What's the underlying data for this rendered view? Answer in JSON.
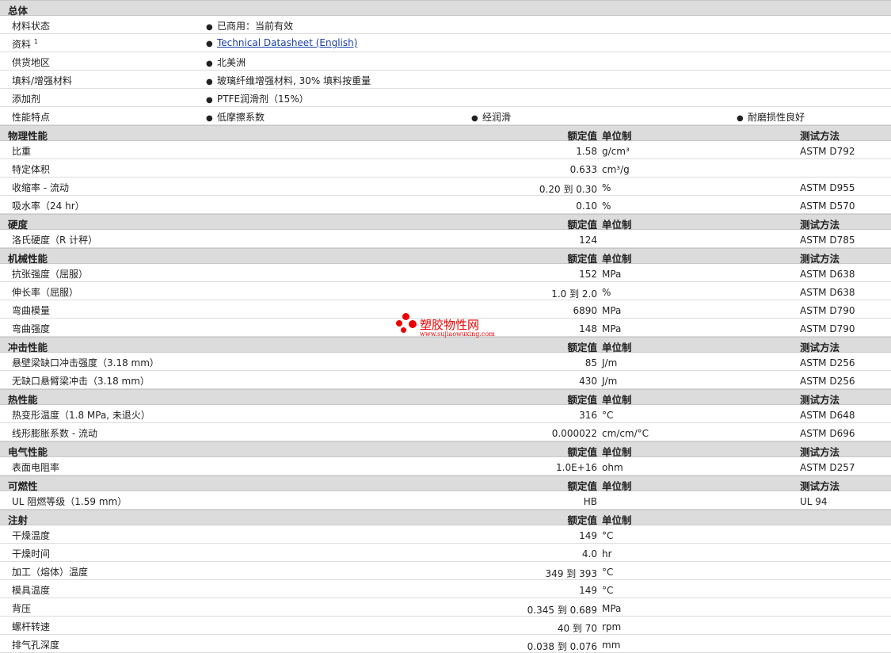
{
  "general": {
    "title": "总体",
    "rows": [
      {
        "label": "材料状态",
        "items": [
          "已商用：当前有效"
        ]
      },
      {
        "label": "资料",
        "sup": "1",
        "link": "Technical Datasheet (English)"
      },
      {
        "label": "供货地区",
        "items": [
          "北美洲"
        ]
      },
      {
        "label": "填料/增强材料",
        "items": [
          "玻璃纤维增强材料, 30% 填料按重量"
        ]
      },
      {
        "label": "添加剂",
        "items": [
          "PTFE润滑剂（15%）"
        ]
      },
      {
        "label": "性能特点",
        "items": [
          "低摩擦系数",
          "经润滑",
          "耐磨损性良好"
        ]
      }
    ]
  },
  "headers": {
    "value": "额定值",
    "unit": "单位制",
    "method": "测试方法"
  },
  "sections": [
    {
      "title": "物理性能",
      "method_header": true,
      "rows": [
        {
          "label": "比重",
          "value": "1.58",
          "unit": "g/cm³",
          "method": "ASTM D792"
        },
        {
          "label": "特定体积",
          "value": "0.633",
          "unit": "cm³/g",
          "method": ""
        },
        {
          "label": "收缩率 - 流动",
          "value": "0.20 到  0.30",
          "unit": "%",
          "method": "ASTM D955"
        },
        {
          "label": "吸水率（24 hr）",
          "value": "0.10",
          "unit": "%",
          "method": "ASTM D570"
        }
      ]
    },
    {
      "title": "硬度",
      "method_header": true,
      "rows": [
        {
          "label": "洛氏硬度（R 计秤）",
          "value": "124",
          "unit": "",
          "method": "ASTM D785"
        }
      ]
    },
    {
      "title": "机械性能",
      "method_header": true,
      "rows": [
        {
          "label": "抗张强度（屈服）",
          "value": "152",
          "unit": "MPa",
          "method": "ASTM D638"
        },
        {
          "label": "伸长率（屈服）",
          "value": "1.0 到  2.0",
          "unit": "%",
          "method": "ASTM D638"
        },
        {
          "label": "弯曲模量",
          "value": "6890",
          "unit": "MPa",
          "method": "ASTM D790"
        },
        {
          "label": "弯曲强度",
          "value": "148",
          "unit": "MPa",
          "method": "ASTM D790"
        }
      ]
    },
    {
      "title": "冲击性能",
      "method_header": true,
      "rows": [
        {
          "label": "悬壁梁缺口冲击强度（3.18 mm）",
          "value": "85",
          "unit": "J/m",
          "method": "ASTM D256"
        },
        {
          "label": "无缺口悬臂梁冲击（3.18 mm）",
          "value": "430",
          "unit": "J/m",
          "method": "ASTM D256"
        }
      ]
    },
    {
      "title": "热性能",
      "method_header": true,
      "rows": [
        {
          "label": "热变形温度（1.8 MPa, 未退火）",
          "value": "316",
          "unit": "°C",
          "method": "ASTM D648"
        },
        {
          "label": "线形膨胀系数 - 流动",
          "value": "0.000022",
          "unit": "cm/cm/°C",
          "method": "ASTM D696"
        }
      ]
    },
    {
      "title": "电气性能",
      "method_header": true,
      "rows": [
        {
          "label": "表面电阻率",
          "value": "1.0E+16",
          "unit": "ohm",
          "method": "ASTM D257"
        }
      ]
    },
    {
      "title": "可燃性",
      "method_header": true,
      "rows": [
        {
          "label": "UL 阻燃等级（1.59 mm）",
          "value": "HB",
          "unit": "",
          "method": "UL 94"
        }
      ]
    },
    {
      "title": "注射",
      "method_header": false,
      "rows": [
        {
          "label": "干燥温度",
          "value": "149",
          "unit": "°C",
          "method": ""
        },
        {
          "label": "干燥时间",
          "value": "4.0",
          "unit": "hr",
          "method": ""
        },
        {
          "label": "加工（熔体）温度",
          "value": "349 到  393",
          "unit": "°C",
          "method": ""
        },
        {
          "label": "模具温度",
          "value": "149",
          "unit": "°C",
          "method": ""
        },
        {
          "label": "背压",
          "value": "0.345 到  0.689",
          "unit": "MPa",
          "method": ""
        },
        {
          "label": "螺杆转速",
          "value": "40 到  70",
          "unit": "rpm",
          "method": ""
        },
        {
          "label": "排气孔深度",
          "value": "0.038 到  0.076",
          "unit": "mm",
          "method": ""
        }
      ]
    }
  ],
  "watermark": {
    "text": "塑胶物性网",
    "url": "www.sujiaowuxing.com",
    "color": "#e00000"
  }
}
